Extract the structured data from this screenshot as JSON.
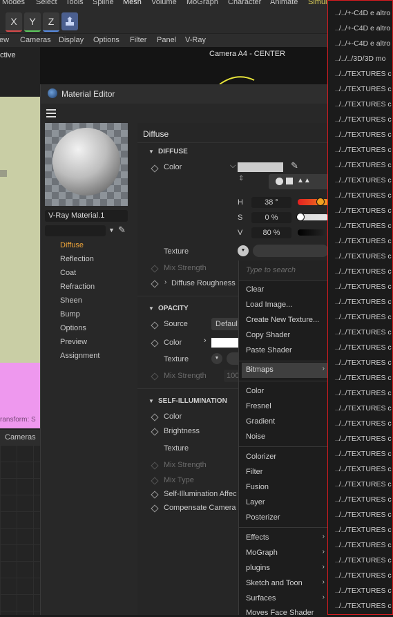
{
  "top_menu": [
    "Modes",
    "Select",
    "Tools",
    "Spline",
    "Mesh",
    "Volume",
    "MoGraph",
    "Character",
    "Animate",
    "Simul"
  ],
  "axes": {
    "x": "X",
    "y": "Y",
    "z": "Z"
  },
  "viewport_menu": [
    "ew",
    "Cameras",
    "Display",
    "Options",
    "Filter",
    "Panel",
    "V-Ray"
  ],
  "viewport": {
    "left_label": "ctive",
    "camera_label": "Camera A4 - CENTER",
    "transform_label": "ransform: S",
    "bottom_tab": "Cameras"
  },
  "material_editor": {
    "title": "Material Editor",
    "material_name": "V-Ray Material.1",
    "channels": [
      "Diffuse",
      "Reflection",
      "Coat",
      "Refraction",
      "Sheen",
      "Bump",
      "Options",
      "Preview",
      "Assignment"
    ],
    "panel_title": "Diffuse",
    "diffuse": {
      "section": "DIFFUSE",
      "color_label": "Color",
      "h_label": "H",
      "h_value": "38 °",
      "s_label": "S",
      "s_value": "0 %",
      "v_label": "V",
      "v_value": "80 %",
      "texture_label": "Texture",
      "mix_strength_label": "Mix Strength",
      "roughness_label": "Diffuse Roughness"
    },
    "opacity": {
      "section": "OPACITY",
      "source_label": "Source",
      "source_value": "Defaul",
      "color_label": "Color",
      "texture_label": "Texture",
      "mix_strength_label": "Mix Strength",
      "mix_strength_value": "100"
    },
    "self_illumination": {
      "section": "SELF-ILLUMINATION",
      "color_label": "Color",
      "brightness_label": "Brightness",
      "texture_label": "Texture",
      "mix_strength_label": "Mix Strength",
      "mix_type_label": "Mix Type",
      "affect_label": "Self-Illumination Affec",
      "compensate_label": "Compensate Camera"
    }
  },
  "popup_menu": {
    "search_placeholder": "Type to search",
    "items_1": [
      "Clear",
      "Load Image...",
      "Create New Texture..."
    ],
    "items_disabled": [
      "Copy Shader",
      "Paste Shader"
    ],
    "highlighted": "Bitmaps",
    "items_2": [
      "Color",
      "Fresnel",
      "Gradient",
      "Noise"
    ],
    "items_3": [
      "Colorizer",
      "Filter",
      "Fusion",
      "Layer",
      "Posterizer"
    ],
    "items_4": [
      "Effects",
      "MoGraph",
      "plugins",
      "Sketch and Toon",
      "Surfaces",
      "Moves Face Shader"
    ]
  },
  "file_list": [
    "../../+-C4D e altro",
    "../../+-C4D e altro",
    "../../+-C4D e altro",
    "../../../3D/3D mo",
    "../../TEXTURES c",
    "../../TEXTURES c",
    "../../TEXTURES c",
    "../../TEXTURES c",
    "../../TEXTURES c",
    "../../TEXTURES c",
    "../../TEXTURES c",
    "../../TEXTURES c",
    "../../TEXTURES c",
    "../../TEXTURES c",
    "../../TEXTURES c",
    "../../TEXTURES c",
    "../../TEXTURES c",
    "../../TEXTURES c",
    "../../TEXTURES c",
    "../../TEXTURES c",
    "../../TEXTURES c",
    "../../TEXTURES c",
    "../../TEXTURES c",
    "../../TEXTURES c",
    "../../TEXTURES c",
    "../../TEXTURES c",
    "../../TEXTURES c",
    "../../TEXTURES c",
    "../../TEXTURES c",
    "../../TEXTURES c",
    "../../TEXTURES c",
    "../../TEXTURES c",
    "../../TEXTURES c",
    "../../TEXTURES c",
    "../../TEXTURES c",
    "../../TEXTURES c",
    "../../TEXTURES c",
    "../../TEXTURES c",
    "../../TEXTURES c",
    "../../TEXTURES c"
  ],
  "colors": {
    "accent": "#e8a33a",
    "border_red": "#d81b20",
    "viewport_green": "#c9cea5",
    "viewport_pink": "#ee98ee",
    "highlight": "#3f3f3f"
  },
  "sliders": {
    "h": 0.38,
    "s": 0.0,
    "v": 0.8
  }
}
